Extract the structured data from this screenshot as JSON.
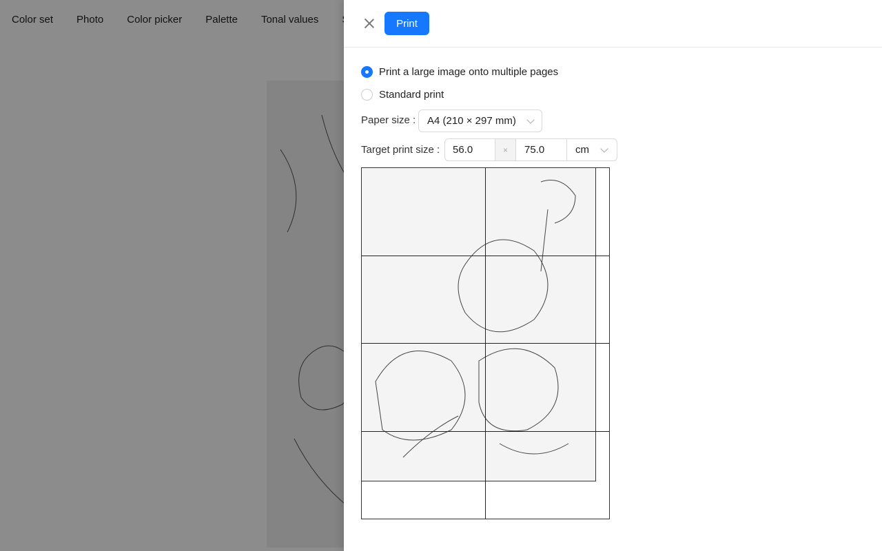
{
  "nav": {
    "tabs": [
      "Color set",
      "Photo",
      "Color picker",
      "Palette",
      "Tonal values",
      "S"
    ]
  },
  "drawer": {
    "print_label": "Print",
    "options": [
      {
        "label": "Print a large image onto multiple pages",
        "selected": true
      },
      {
        "label": "Standard print",
        "selected": false
      }
    ],
    "paper_size_label": "Paper size",
    "paper_size_value": "A4 (210 × 297 mm)",
    "target_label": "Target print size",
    "width": "56.0",
    "times": "×",
    "height": "75.0",
    "unit": "cm"
  },
  "colors": {
    "accent": "#1677ff"
  }
}
